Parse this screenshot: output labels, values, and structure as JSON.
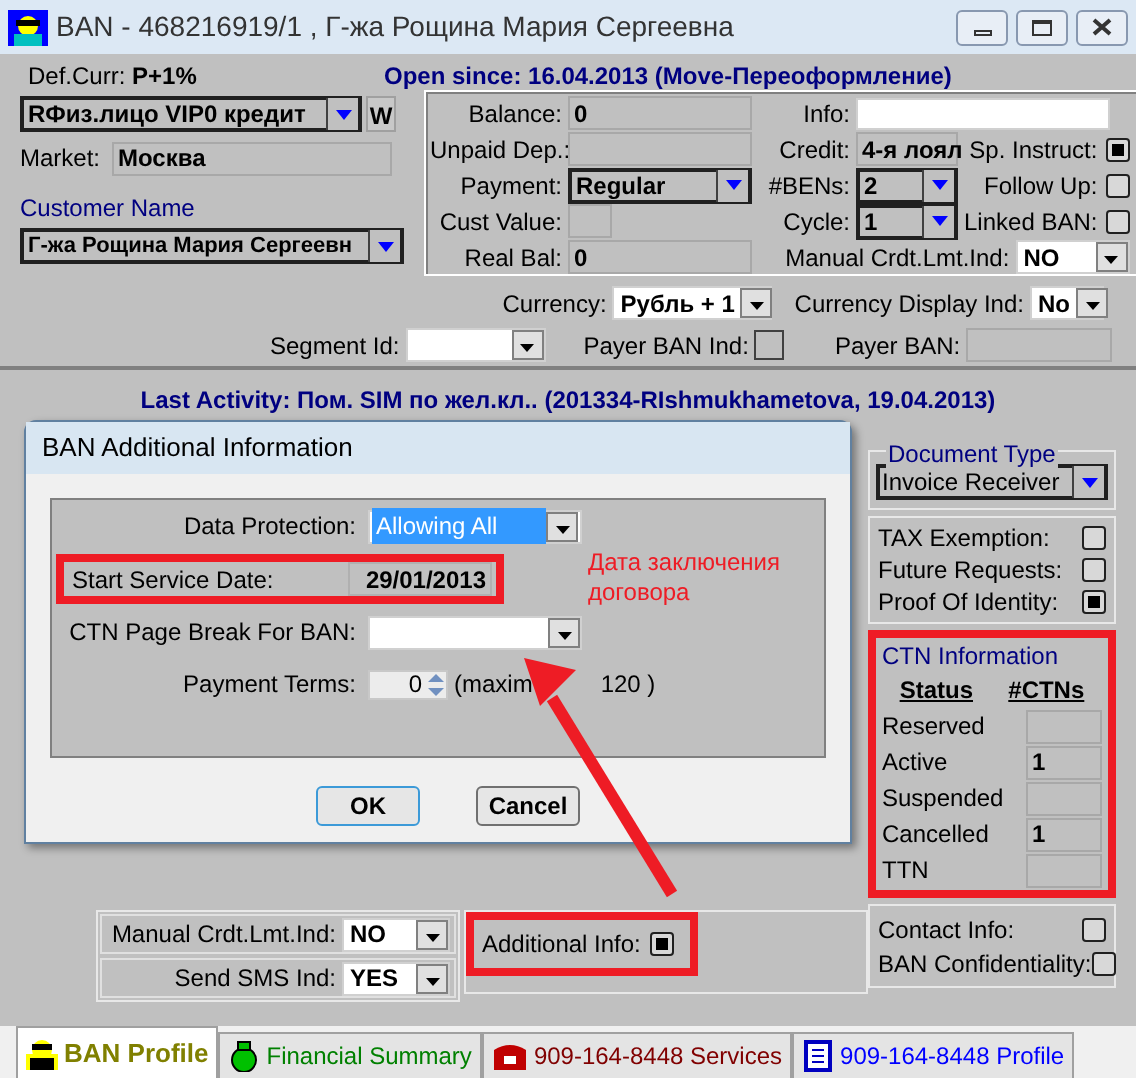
{
  "window": {
    "title": "BAN - 468216919/1 , Г-жа Рощина Мария Сергеевна"
  },
  "header": {
    "def_curr_label": "Def.Curr:",
    "def_curr_value": "Р+1%",
    "open_since": "Open since: 16.04.2013 (Move-Переоформление)",
    "account_type": "RФиз.лицо  VIP0  кредит",
    "w_button": "W",
    "market_label": "Market:",
    "market_value": "Москва",
    "customer_name_label": "Customer Name",
    "customer_name": "Г-жа Рощина Мария Сергеевн"
  },
  "account_fields": [
    {
      "label": "Balance:",
      "value": "0",
      "kind": "text"
    },
    {
      "label": "Unpaid Dep.:",
      "kind": "text"
    },
    {
      "label": "Payment:",
      "value": "Regular",
      "kind": "combo"
    },
    {
      "label": "Cust Value:",
      "kind": "short"
    },
    {
      "label": "Real Bal:",
      "value": "0",
      "kind": "text"
    }
  ],
  "credit_fields": [
    {
      "label": "Info:",
      "kind": "input"
    },
    {
      "label": "Credit:",
      "value": "4-я лоял",
      "kind": "text"
    },
    {
      "label": "#BENs:",
      "value": "2",
      "kind": "combo"
    },
    {
      "label": "Cycle:",
      "value": "1",
      "kind": "combo"
    }
  ],
  "account_flags": [
    {
      "label": "Sp. Instruct:",
      "checked": true
    },
    {
      "label": "Follow Up:",
      "checked": false
    },
    {
      "label": "Linked BAN:",
      "checked": false
    }
  ],
  "manual_limit": {
    "label": "Manual Crdt.Lmt.Ind:",
    "value": "NO"
  },
  "currency": {
    "label": "Currency:",
    "value": "Рубль + 1",
    "display_label": "Currency Display Ind:",
    "display_value": "No"
  },
  "segment": {
    "label": "Segment Id:",
    "payer_ind_label": "Payer BAN Ind:",
    "payer_ind_checked": false,
    "payer_ban_label": "Payer BAN:"
  },
  "last_activity": "Last Activity: Пом. SIM по жел.кл.. (201334-RIshmukhametova, 19.04.2013)",
  "document_type": {
    "legend": "Document Type",
    "value": "Invoice Receiver"
  },
  "document_flags": [
    {
      "label": "TAX Exemption:",
      "checked": false
    },
    {
      "label": "Future Requests:",
      "checked": false
    },
    {
      "label": "Proof Of Identity:",
      "checked": true
    }
  ],
  "ctn_information": {
    "legend": "CTN Information",
    "columns": [
      "Status",
      "#CTNs"
    ],
    "rows": [
      {
        "status": "Reserved"
      },
      {
        "status": "Active",
        "count": "1"
      },
      {
        "status": "Suspended"
      },
      {
        "status": "Cancelled",
        "count": "1"
      },
      {
        "status": "TTN"
      }
    ]
  },
  "contact_flags": [
    {
      "label": "Contact Info:",
      "checked": false
    },
    {
      "label": "BAN Confidentiality:",
      "checked": false
    }
  ],
  "indicators": [
    {
      "label": "Manual Crdt.Lmt.Ind:",
      "value": "NO"
    },
    {
      "label": "Send SMS Ind:",
      "value": "YES"
    }
  ],
  "additional_info": {
    "label": "Additional Info:",
    "checked": true
  },
  "dialog": {
    "title": "BAN Additional Information",
    "data_protection": {
      "label": "Data Protection:",
      "value": "Allowing All",
      "focused": true
    },
    "start_service": {
      "label": "Start Service Date:",
      "value": "29/01/2013"
    },
    "ctn_page_break": {
      "label": "CTN Page Break For BAN:"
    },
    "payment_terms": {
      "label": "Payment Terms:",
      "value": "0",
      "hint_start": "(maxim",
      "hint_end": "120 )"
    },
    "buttons": [
      "OK",
      "Cancel"
    ]
  },
  "annotation": {
    "note": "Дата заключения договора"
  },
  "tabs": [
    {
      "label": "BAN Profile",
      "selected": true,
      "color": "#808000",
      "kind": "agent"
    },
    {
      "label": "Financial Summary",
      "selected": false,
      "color": "#008000",
      "kind": "money"
    },
    {
      "label": "909-164-8448 Services",
      "selected": false,
      "color": "#800000",
      "kind": "phone"
    },
    {
      "label": "909-164-8448 Profile",
      "selected": false,
      "color": "#0000ff",
      "kind": "doc"
    }
  ]
}
